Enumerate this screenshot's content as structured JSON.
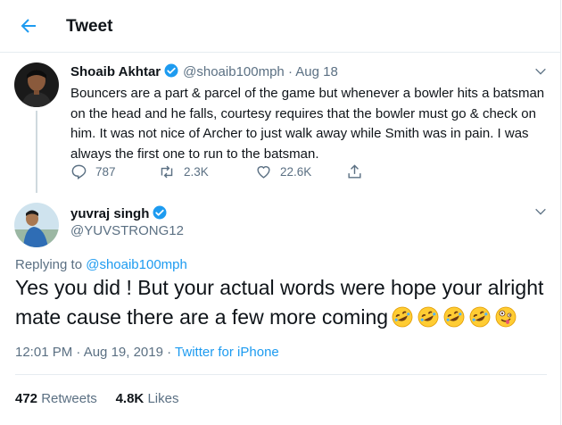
{
  "header": {
    "title": "Tweet"
  },
  "original_tweet": {
    "author_name": "Shoaib Akhtar",
    "handle": "@shoaib100mph",
    "dot": "·",
    "date": "Aug 18",
    "text": "Bouncers are a part & parcel of the game but whenever a bowler hits a batsman on the head and he falls, courtesy requires that the bowler must go & check on him. It was not nice of Archer to just walk away while Smith was in pain. I was always the first one to run to the batsman.",
    "replies": "787",
    "retweets": "2.3K",
    "likes": "22.6K"
  },
  "reply_tweet": {
    "author_name": "yuvraj singh",
    "handle": "@YUVSTRONG12",
    "replying_prefix": "Replying to",
    "replying_to": "@shoaib100mph",
    "text": "Yes you did ! But your actual words were hope your alright mate cause there are a few more coming",
    "emojis": [
      "rolling-on-floor-laughing",
      "rolling-on-floor-laughing",
      "rolling-on-floor-laughing",
      "rolling-on-floor-laughing",
      "zany-face"
    ],
    "time": "12:01 PM · Aug 19, 2019 ·",
    "source": "Twitter for iPhone",
    "retweet_count": "472",
    "retweet_label": "Retweets",
    "like_count": "4.8K",
    "like_label": "Likes"
  },
  "colors": {
    "accent": "#1d9bf0",
    "muted": "#5b7083",
    "border": "#e6ecf0",
    "text": "#0f1419"
  }
}
